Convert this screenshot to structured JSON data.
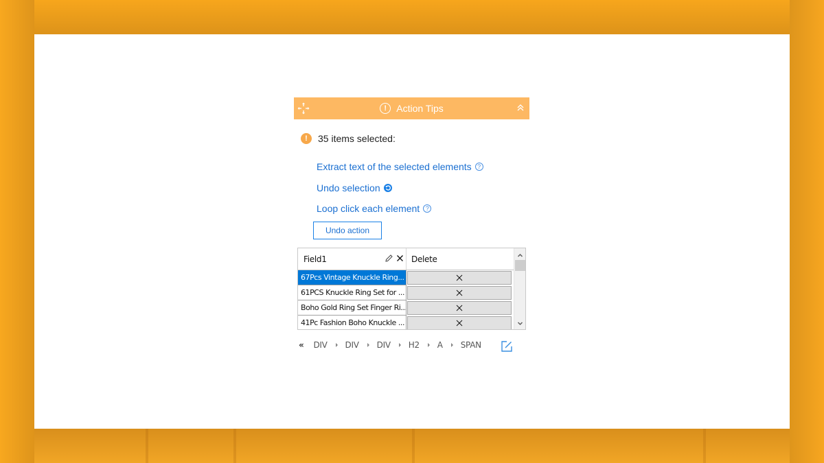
{
  "header": {
    "title": "Action Tips",
    "icons": {
      "move": "move-icon",
      "alert": "alert-circle-icon",
      "collapse": "chevron-double-up-icon"
    }
  },
  "status": {
    "text": "35 items selected:",
    "icon": "warning-icon",
    "count": 35
  },
  "actions": [
    {
      "label": "Extract text of the selected elements",
      "icon": "help-icon"
    },
    {
      "label": "Undo selection",
      "icon": "undo-selection-icon"
    },
    {
      "label": "Loop click each element",
      "icon": "help-icon"
    }
  ],
  "undo_action_button": "Undo action",
  "grid": {
    "columns": [
      "Field1",
      "Delete"
    ],
    "header_icons": [
      "pencil-icon",
      "close-icon"
    ],
    "rows": [
      {
        "field1": "67Pcs Vintage Knuckle Ring...",
        "selected": true
      },
      {
        "field1": "61PCS Knuckle Ring Set for ...",
        "selected": false
      },
      {
        "field1": "Boho Gold Ring Set Finger Ri...",
        "selected": false
      },
      {
        "field1": "41Pc Fashion Boho Knuckle ...",
        "selected": false
      }
    ],
    "delete_icon": "close-icon"
  },
  "breadcrumb": {
    "back_icon": "double-chevron-left-icon",
    "back_label": "«",
    "items": [
      "DIV",
      "DIV",
      "DIV",
      "H2",
      "A",
      "SPAN"
    ],
    "open_icon": "open-external-icon"
  },
  "colors": {
    "header_bg": "#fdb862",
    "link": "#1a6fd1",
    "selected_row": "#0078d7",
    "warning": "#f7a84a",
    "background": "#e29a20"
  }
}
